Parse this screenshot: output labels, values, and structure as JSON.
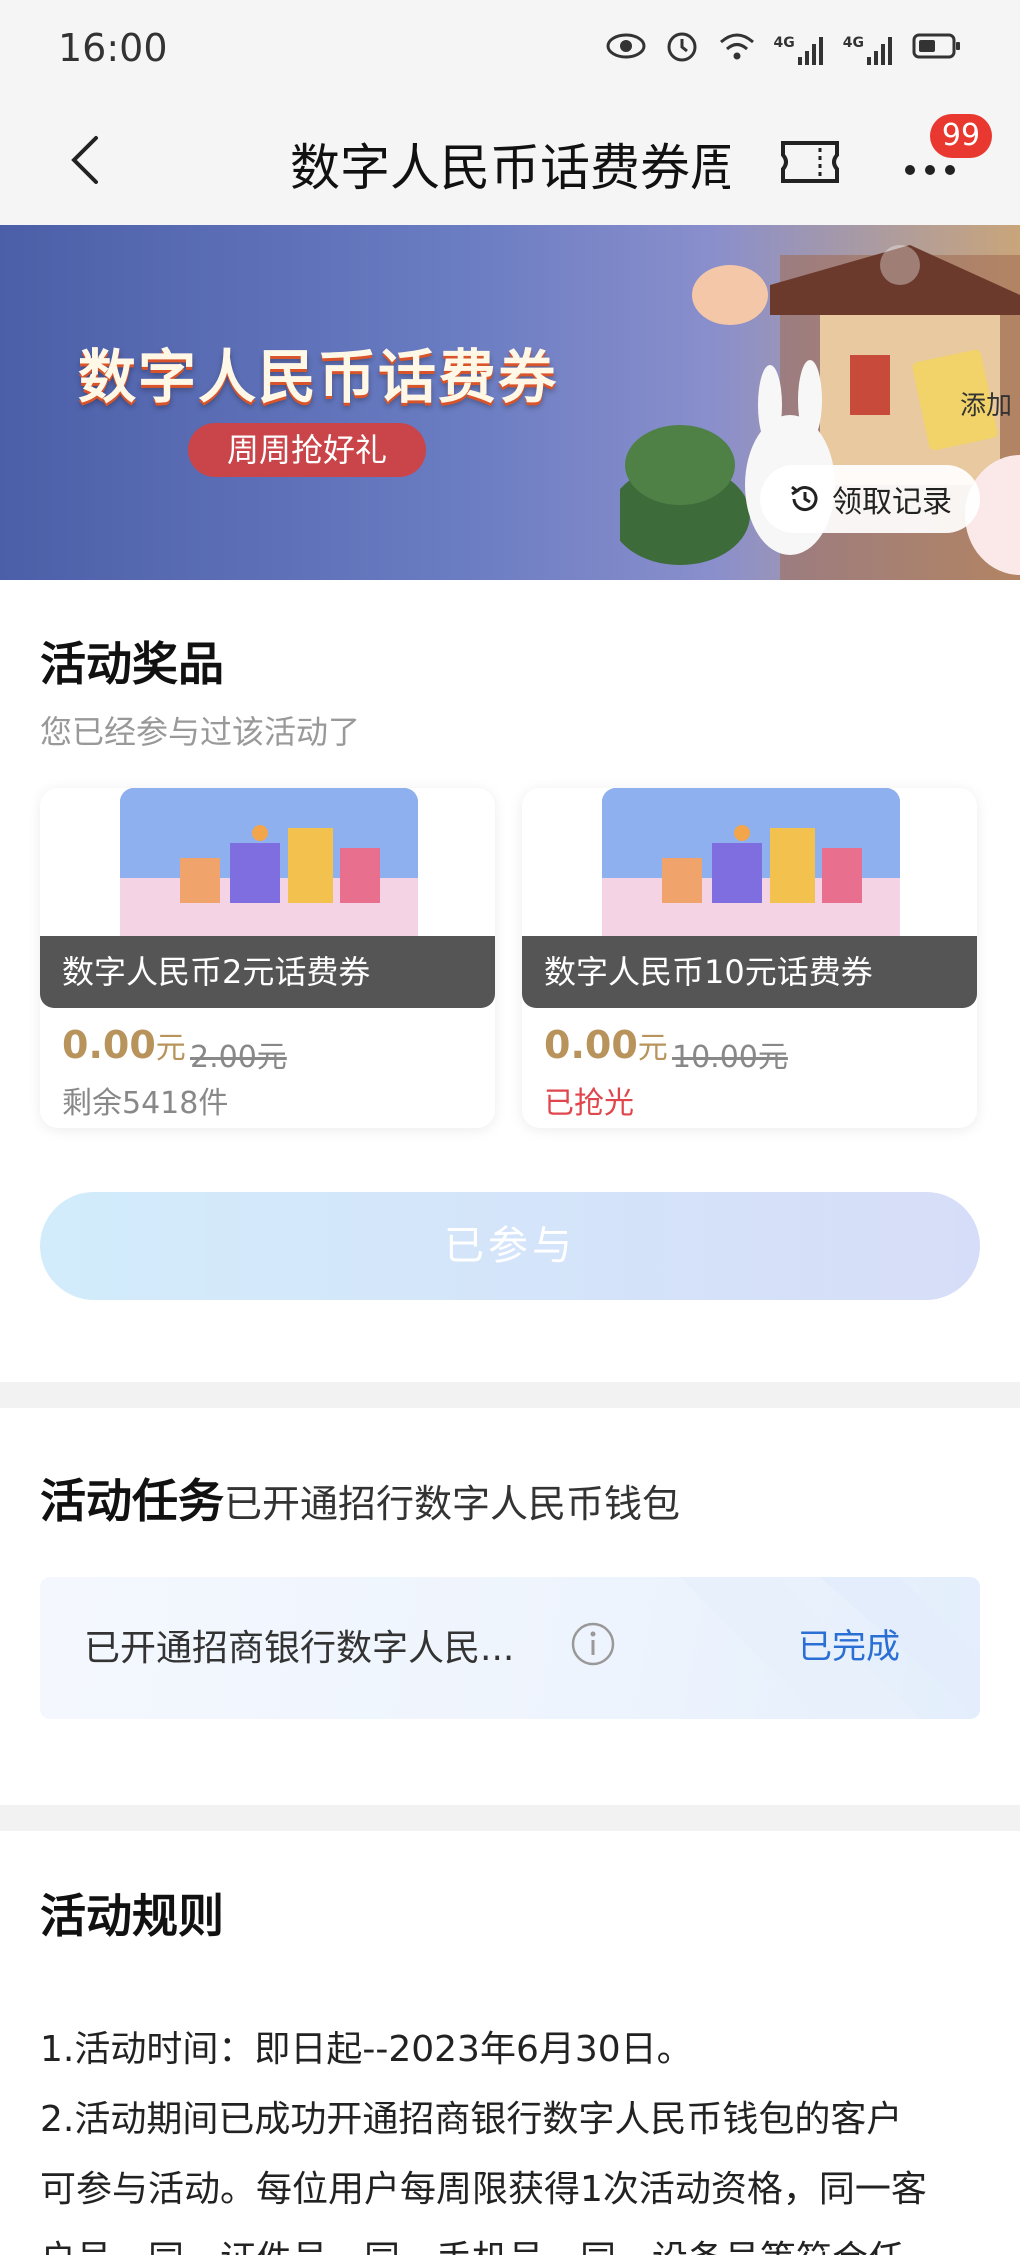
{
  "status_bar": {
    "time": "16:00",
    "network_1": "4G",
    "network_2": "4G"
  },
  "nav": {
    "title": "数字人民币话费券周",
    "badge_count": "99"
  },
  "banner": {
    "title": "数字人民币话费券",
    "subtitle": "周周抢好礼",
    "add_label": "添加",
    "record_label": "领取记录"
  },
  "prizes_section": {
    "title": "活动奖品",
    "participated_note": "您已经参与过该活动了",
    "items": [
      {
        "name": "数字人民币2元话费券",
        "price": "0.00",
        "unit": "元",
        "original_price": "2.00元",
        "stock": "剩余5418件"
      },
      {
        "name": "数字人民币10元话费券",
        "price": "0.00",
        "unit": "元",
        "original_price": "10.00元",
        "stock": "已抢光"
      }
    ],
    "join_button": "已参与"
  },
  "task_section": {
    "title": "活动任务",
    "subtitle": "已开通招行数字人民币钱包",
    "task_text": "已开通招商银行数字人民...",
    "task_status": "已完成"
  },
  "rules_section": {
    "title": "活动规则",
    "lines": [
      "1.活动时间：即日起--2023年6月30日。",
      "2.活动期间已成功开通招商银行数字人民币钱包的客户",
      "可参与活动。每位用户每周限获得1次活动资格，同一客",
      "户号、同一证件号、同一手机号、同一设备号等符合任"
    ]
  },
  "colors": {
    "accent_blue": "#2a6fd4",
    "price_gold": "#b8945c",
    "soldout_red": "#e0474c",
    "badge_red": "#e8382f"
  }
}
